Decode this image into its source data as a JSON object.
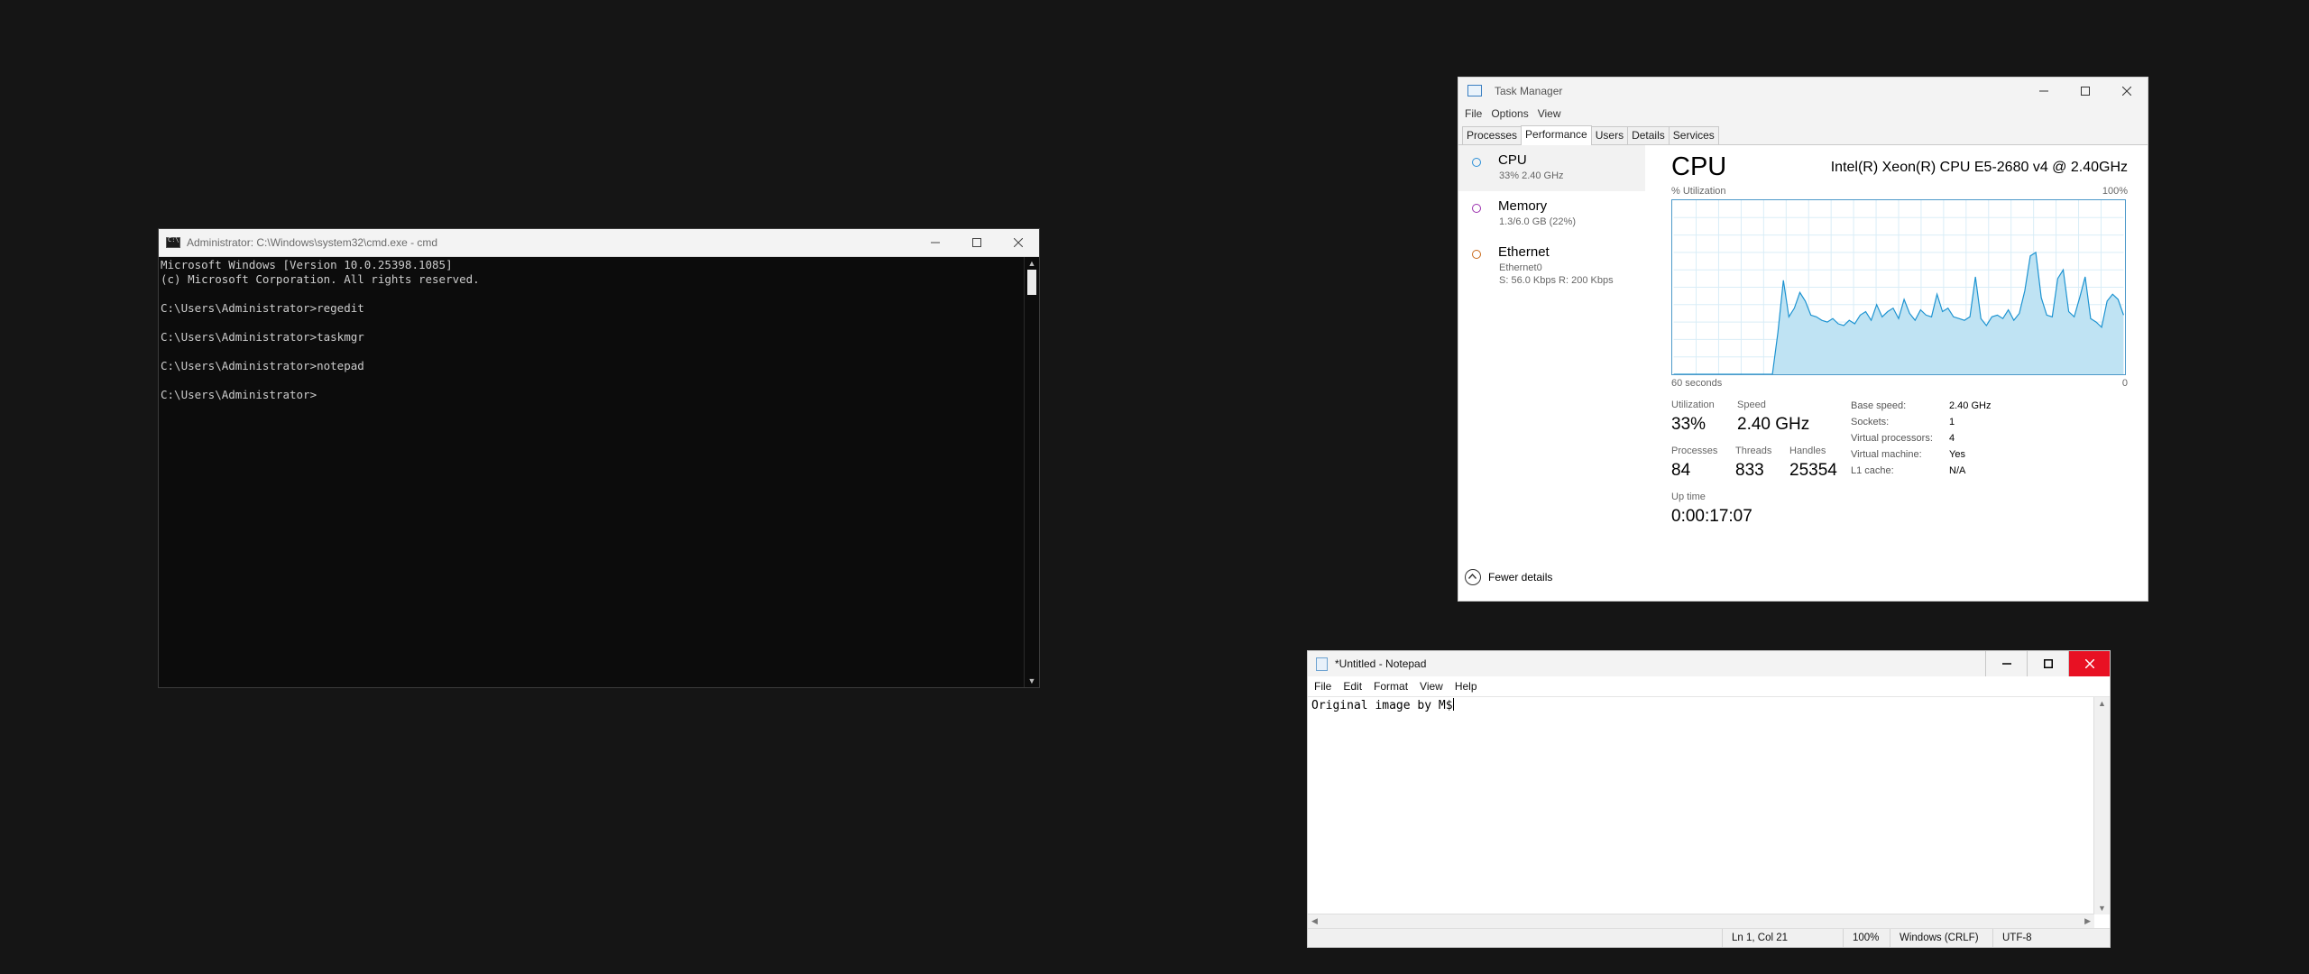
{
  "cmd": {
    "title": "Administrator: C:\\Windows\\system32\\cmd.exe - cmd",
    "lines": [
      "Microsoft Windows [Version 10.0.25398.1085]",
      "(c) Microsoft Corporation. All rights reserved.",
      "",
      "C:\\Users\\Administrator>regedit",
      "",
      "C:\\Users\\Administrator>taskmgr",
      "",
      "C:\\Users\\Administrator>notepad",
      "",
      "C:\\Users\\Administrator>"
    ]
  },
  "taskmanager": {
    "title": "Task Manager",
    "menu": [
      "File",
      "Options",
      "View"
    ],
    "tabs": [
      "Processes",
      "Performance",
      "Users",
      "Details",
      "Services"
    ],
    "active_tab": "Performance",
    "sidebar": [
      {
        "name": "CPU",
        "sub": "33% 2.40 GHz",
        "color": "#2b8fd8"
      },
      {
        "name": "Memory",
        "sub": "1.3/6.0 GB (22%)",
        "color": "#9b2fae"
      },
      {
        "name": "Ethernet",
        "sub": "Ethernet0",
        "sub2": "S: 56.0 Kbps R: 200 Kbps",
        "color": "#c9691a"
      }
    ],
    "cpu_title": "CPU",
    "cpu_model": "Intel(R) Xeon(R) CPU E5-2680 v4 @ 2.40GHz",
    "util_label": "% Utilization",
    "util_max": "100%",
    "time_left": "60 seconds",
    "time_right": "0",
    "stats": {
      "utilization_label": "Utilization",
      "utilization": "33%",
      "speed_label": "Speed",
      "speed": "2.40 GHz",
      "processes_label": "Processes",
      "processes": "84",
      "threads_label": "Threads",
      "threads": "833",
      "handles_label": "Handles",
      "handles": "25354",
      "uptime_label": "Up time",
      "uptime": "0:00:17:07"
    },
    "details": [
      {
        "k": "Base speed:",
        "v": "2.40 GHz"
      },
      {
        "k": "Sockets:",
        "v": "1"
      },
      {
        "k": "Virtual processors:",
        "v": "4"
      },
      {
        "k": "Virtual machine:",
        "v": "Yes"
      },
      {
        "k": "L1 cache:",
        "v": "N/A"
      }
    ],
    "fewer_details": "Fewer details",
    "graph_colors": {
      "line": "#1c93d1",
      "fill": "#bfe3f3",
      "grid": "#d9edf7"
    },
    "cpu_history_percent": [
      0,
      0,
      0,
      0,
      0,
      0,
      0,
      0,
      0,
      0,
      0,
      0,
      0,
      0,
      0,
      0,
      0,
      0,
      0,
      24,
      54,
      33,
      38,
      47,
      42,
      34,
      33,
      31,
      30,
      32,
      29,
      28,
      31,
      29,
      34,
      36,
      31,
      40,
      33,
      36,
      38,
      32,
      43,
      35,
      31,
      37,
      34,
      33,
      46,
      36,
      38,
      33,
      32,
      31,
      33,
      56,
      32,
      28,
      33,
      34,
      32,
      37,
      31,
      35,
      48,
      68,
      70,
      44,
      34,
      33,
      55,
      60,
      36,
      33,
      44,
      56,
      32,
      30,
      27,
      42,
      46,
      43,
      34
    ]
  },
  "notepad": {
    "title": "*Untitled - Notepad",
    "menu": [
      "File",
      "Edit",
      "Format",
      "View",
      "Help"
    ],
    "text": "Original image by M$",
    "status": {
      "position": "Ln 1, Col 21",
      "zoom": "100%",
      "eol": "Windows (CRLF)",
      "encoding": "UTF-8"
    }
  }
}
